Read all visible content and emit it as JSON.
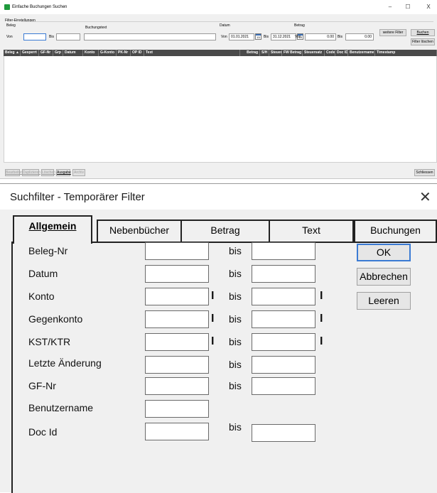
{
  "top_window": {
    "title": "Einfache Buchungen Suchen",
    "controls": {
      "minimize": "–",
      "maximize": "☐",
      "close": "X"
    },
    "filter_group": "Filter-Einstellungen",
    "beleg": {
      "label": "Beleg",
      "von": "Von",
      "bis": "Bis"
    },
    "buchungstext_label": "Buchungstext",
    "datum": {
      "label": "Datum",
      "von": "Von",
      "von_value": "01.01.2021",
      "bis": "Bis",
      "bis_value": "31.12.2021"
    },
    "betrag": {
      "label": "Betrag",
      "von": "Von",
      "von_value": "0.00",
      "bis": "Bis",
      "bis_value": "0.00"
    },
    "buttons": {
      "weitere_filter": "weitere Filter",
      "buchen": "Buchen",
      "filter_loeschen": "Filter löschen"
    },
    "calendar_day": "15",
    "columns": [
      "Beleg ▲",
      "Gesperrt",
      "GF-Nr",
      "Grp",
      "Datum",
      "Konto",
      "G-Konto",
      "PK-Nr",
      "OP ID",
      "Text",
      "Betrag",
      "S/H",
      "Steuer",
      "FW Betrag",
      "Steuersatz",
      "Code",
      "Doc ID",
      "Benutzername",
      "Timestamp"
    ],
    "footer_buttons": [
      "Bearbeiten",
      "Duplizieren",
      "Löschen",
      "Ausgabe",
      "Archiv"
    ],
    "schliessen": "Schliessen"
  },
  "dialog": {
    "title": "Suchfilter - Temporärer Filter",
    "close": "✕",
    "tabs": [
      "Allgemein",
      "Nebenbücher",
      "Betrag",
      "Text",
      "Buchungen"
    ],
    "active_tab": "Allgemein",
    "bis": "bis",
    "fields": [
      "Beleg-Nr",
      "Datum",
      "Konto",
      "Gegenkonto",
      "KST/KTR",
      "Letzte Änderung",
      "GF-Nr",
      "Benutzername",
      "Doc Id"
    ],
    "buttons": {
      "ok": "OK",
      "abbrechen": "Abbrechen",
      "leeren": "Leeren"
    }
  }
}
